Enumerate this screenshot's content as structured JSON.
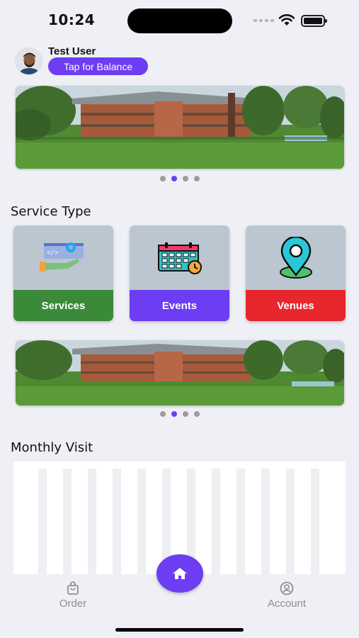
{
  "status_bar": {
    "time": "10:24"
  },
  "profile": {
    "name": "Test User",
    "balance_button": "Tap for Balance",
    "avatar": "user-avatar-photo"
  },
  "banners": [
    {
      "image": "resort-building-lawn",
      "dots": 4,
      "active_index": 1
    },
    {
      "image": "resort-building-lawn",
      "dots": 4,
      "active_index": 1
    }
  ],
  "service_type": {
    "title": "Service Type",
    "cards": [
      {
        "label": "Services",
        "icon": "code-settings-icon",
        "color": "#3a8a3a"
      },
      {
        "label": "Events",
        "icon": "calendar-clock-icon",
        "color": "#6c3df3"
      },
      {
        "label": "Venues",
        "icon": "location-pin-icon",
        "color": "#e8262e"
      }
    ]
  },
  "monthly_visit": {
    "title": "Monthly Visit"
  },
  "bottom_nav": {
    "order_label": "Order",
    "account_label": "Account",
    "home_icon": "home-icon"
  },
  "colors": {
    "accent": "#6c3df3",
    "services": "#3a8a3a",
    "events": "#6c3df3",
    "venues": "#e8262e"
  }
}
